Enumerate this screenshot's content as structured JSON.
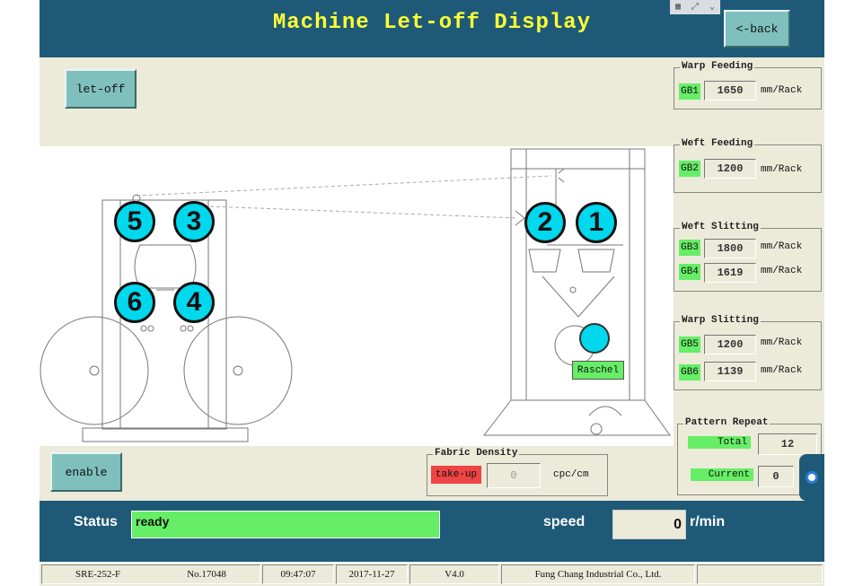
{
  "header": {
    "title": "Machine Let-off Display",
    "back_label": "<-back"
  },
  "left": {
    "letoff_label": "let-off",
    "enable_label": "enable"
  },
  "diagram": {
    "circles": [
      "5",
      "3",
      "6",
      "4",
      "2",
      "1"
    ],
    "raschel_label": "Raschel"
  },
  "warp_feeding": {
    "title": "Warp Feeding",
    "rows": [
      {
        "gb": "GB1",
        "value": "1650",
        "unit": "mm/Rack"
      }
    ]
  },
  "weft_feeding": {
    "title": "Weft Feeding",
    "rows": [
      {
        "gb": "GB2",
        "value": "1200",
        "unit": "mm/Rack"
      }
    ]
  },
  "weft_slitting": {
    "title": "Weft Slitting",
    "rows": [
      {
        "gb": "GB3",
        "value": "1800",
        "unit": "mm/Rack"
      },
      {
        "gb": "GB4",
        "value": "1619",
        "unit": "mm/Rack"
      }
    ]
  },
  "warp_slitting": {
    "title": "Warp Slitting",
    "rows": [
      {
        "gb": "GB5",
        "value": "1200",
        "unit": "mm/Rack"
      },
      {
        "gb": "GB6",
        "value": "1139",
        "unit": "mm/Rack"
      }
    ]
  },
  "pattern_repeat": {
    "title": "Pattern Repeat",
    "total_label": "Total",
    "total_value": "12",
    "current_label": "Current",
    "current_value": "0"
  },
  "fabric_density": {
    "title": "Fabric Density",
    "takeup_label": "take-up",
    "value": "0",
    "unit": "cpc/cm"
  },
  "status": {
    "label": "Status",
    "value": "ready",
    "speed_label": "speed",
    "speed_value": "0",
    "speed_unit": "r/min"
  },
  "footer": {
    "model": "SRE-252-F",
    "number": "No.17048",
    "time": "09:47:07",
    "date": "2017-11-27",
    "version": "V4.0",
    "company": "Fung Chang Industrial Co., Ltd."
  },
  "colors": {
    "header_bg": "#1e5a78",
    "title": "#ffff33",
    "gb_green": "#66ee66",
    "takeup_red": "#ee4444",
    "roller": "#00d8ee"
  }
}
